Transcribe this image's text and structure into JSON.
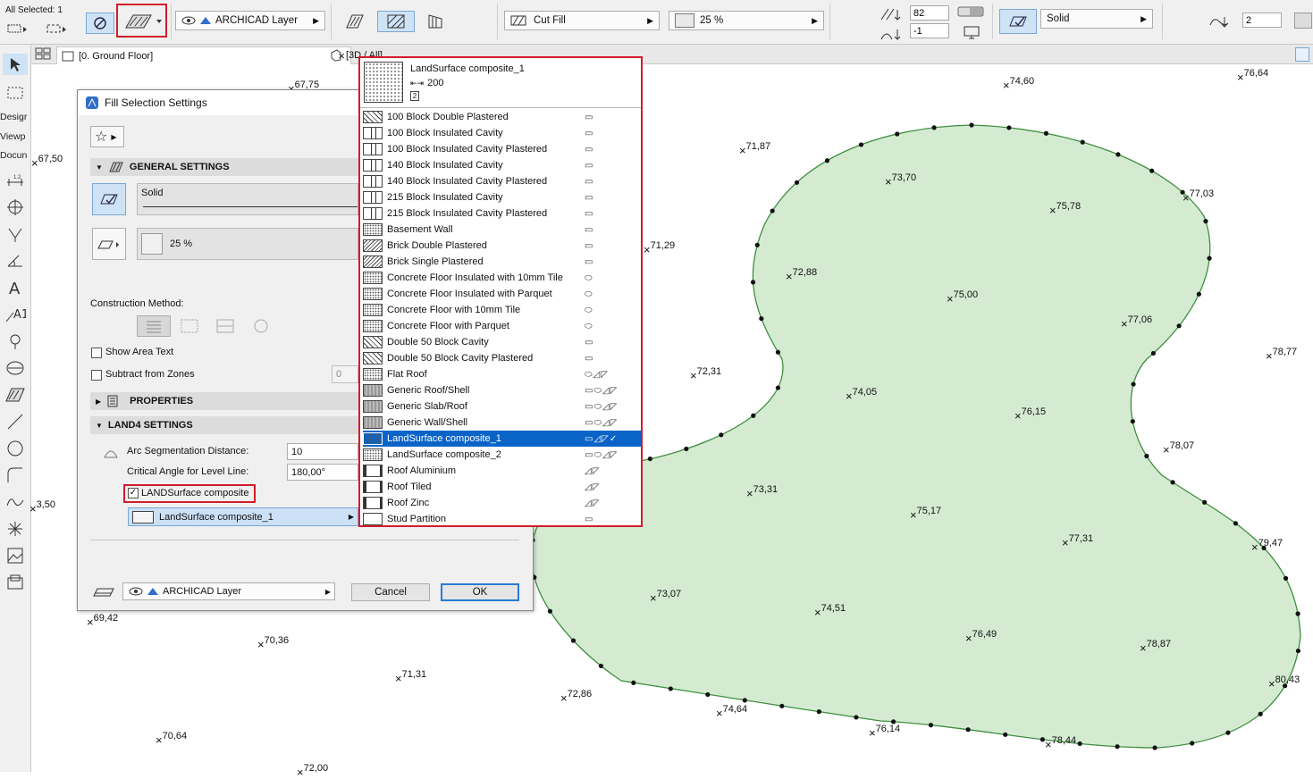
{
  "toolbar": {
    "selection_info": "All Selected: 1",
    "layer": "ARCHICAD Layer",
    "cut_fill": "Cut Fill",
    "percent": "25 %",
    "val1": "82",
    "val2": "-1",
    "line_type": "Solid",
    "pen": "2"
  },
  "toolbox": {
    "labels": [
      "Desigr",
      "Viewp",
      "Docun"
    ]
  },
  "tabs": [
    {
      "label": "[0. Ground Floor]",
      "close": "×"
    },
    {
      "label": "[3D / All]"
    }
  ],
  "dialog": {
    "title": "Fill Selection Settings",
    "general_settings": "GENERAL SETTINGS",
    "line_type": "Solid",
    "fill_percent": "25 %",
    "construction_method": "Construction Method:",
    "show_area_text": "Show Area Text",
    "subtract_from_zones": "Subtract from Zones",
    "subtract_value": "0",
    "properties": "PROPERTIES",
    "land4_settings": "LAND4 SETTINGS",
    "arc_segmentation_label": "Arc Segmentation Distance:",
    "arc_segmentation_value": "10",
    "critical_angle_label": "Critical Angle for Level Line:",
    "critical_angle_value": "180,00°",
    "landsurface_checkbox": "LANDSurface composite",
    "composite_value": "LandSurface composite_1",
    "layer": "ARCHICAD Layer",
    "cancel": "Cancel",
    "ok": "OK"
  },
  "popup": {
    "header_name": "LandSurface composite_1",
    "header_thickness": "200",
    "header_count": "2",
    "items": [
      {
        "label": "100 Block Double Plastered",
        "flags": "▭"
      },
      {
        "label": "100 Block Insulated Cavity",
        "flags": "▭"
      },
      {
        "label": "100 Block Insulated Cavity Plastered",
        "flags": "▭"
      },
      {
        "label": "140 Block Insulated Cavity",
        "flags": "▭"
      },
      {
        "label": "140 Block Insulated Cavity Plastered",
        "flags": "▭"
      },
      {
        "label": "215 Block Insulated Cavity",
        "flags": "▭"
      },
      {
        "label": "215 Block Insulated Cavity Plastered",
        "flags": "▭"
      },
      {
        "label": "Basement Wall",
        "flags": "▭"
      },
      {
        "label": "Brick Double Plastered",
        "flags": "▭"
      },
      {
        "label": "Brick Single Plastered",
        "flags": "▭"
      },
      {
        "label": "Concrete Floor Insulated with 10mm Tile",
        "flags": "  ⬭"
      },
      {
        "label": "Concrete Floor Insulated with Parquet",
        "flags": "  ⬭"
      },
      {
        "label": "Concrete Floor with 10mm Tile",
        "flags": "  ⬭"
      },
      {
        "label": "Concrete Floor with Parquet",
        "flags": "  ⬭"
      },
      {
        "label": "Double 50 Block Cavity",
        "flags": "▭"
      },
      {
        "label": "Double 50 Block Cavity Plastered",
        "flags": "▭"
      },
      {
        "label": "Flat Roof",
        "flags": "  ⬭◿◸"
      },
      {
        "label": "Generic Roof/Shell",
        "flags": "▭⬭◿◸"
      },
      {
        "label": "Generic Slab/Roof",
        "flags": "▭⬭◿◸"
      },
      {
        "label": "Generic Wall/Shell",
        "flags": "▭⬭◿◸"
      },
      {
        "label": "LandSurface composite_1",
        "flags": "▭◿◸✓",
        "selected": true
      },
      {
        "label": "LandSurface composite_2",
        "flags": "▭⬭◿◸"
      },
      {
        "label": "Roof Aluminium",
        "flags": "    ◿◸"
      },
      {
        "label": "Roof Tiled",
        "flags": "    ◿◸"
      },
      {
        "label": "Roof Zinc",
        "flags": "    ◿◸"
      },
      {
        "label": "Stud Partition",
        "flags": "▭"
      }
    ]
  },
  "canvas": {
    "fill_color": "#d4ebd2",
    "edge_color": "#3f8f3f",
    "points": [
      {
        "label": "67,75"
      },
      {
        "label": "74,60"
      },
      {
        "label": "76,64"
      },
      {
        "label": "71,87"
      },
      {
        "label": "73,70"
      },
      {
        "label": "75,78"
      },
      {
        "label": "77,03"
      },
      {
        "label": "67,50"
      },
      {
        "label": "71,29"
      },
      {
        "label": "72,88"
      },
      {
        "label": "75,00"
      },
      {
        "label": "77,06"
      },
      {
        "label": "78,77"
      },
      {
        "label": "72,31"
      },
      {
        "label": "74,05"
      },
      {
        "label": "76,15"
      },
      {
        "label": "78,07"
      },
      {
        "label": "73,31"
      },
      {
        "label": "75,17"
      },
      {
        "label": "77,31"
      },
      {
        "label": "79,47"
      },
      {
        "label": "3,50"
      },
      {
        "label": "73,07"
      },
      {
        "label": "74,51"
      },
      {
        "label": "76,49"
      },
      {
        "label": "78,87"
      },
      {
        "label": "69,42"
      },
      {
        "label": "70,36"
      },
      {
        "label": "71,31"
      },
      {
        "label": "72,86"
      },
      {
        "label": "74,64"
      },
      {
        "label": "76,14"
      },
      {
        "label": "78,44"
      },
      {
        "label": "80,43"
      },
      {
        "label": "70,64"
      },
      {
        "label": "72,00"
      }
    ]
  }
}
